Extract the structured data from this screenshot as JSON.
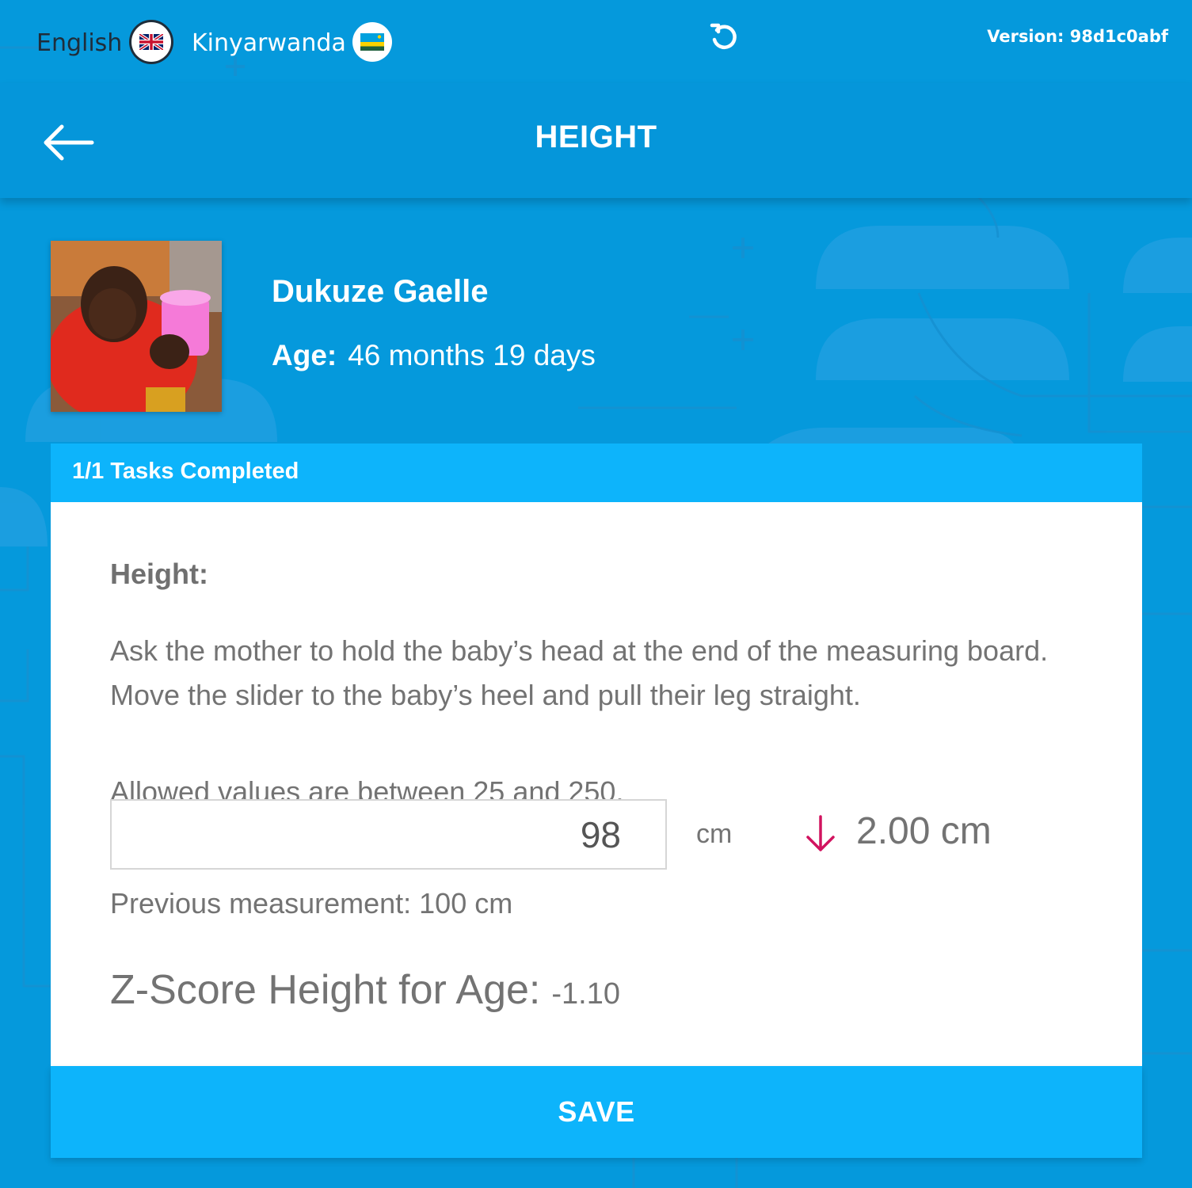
{
  "colors": {
    "background": "#0599dc",
    "header": "#0596da",
    "accent_bar": "#0db4fb",
    "card": "#ffffff",
    "text_gray": "#737373",
    "arrow_down": "#d1135f"
  },
  "language_bar": {
    "english_label": "English",
    "english_flag_icon": "uk-flag-icon",
    "kinyarwanda_label": "Kinyarwanda",
    "kinyarwanda_flag_icon": "rwanda-flag-icon",
    "refresh_icon": "refresh-icon",
    "version": "Version: 98d1c0abf"
  },
  "header": {
    "back_icon": "arrow-left-icon",
    "title": "HEIGHT"
  },
  "person": {
    "name": "Dukuze Gaelle",
    "age_label": "Age:",
    "age_value": "46 months 19 days"
  },
  "card": {
    "tasks_completed": "1/1 Tasks Completed",
    "field_title": "Height:",
    "instructions": "Ask the mother to hold the baby’s head at the end of the measuring board. Move the slider to the baby’s heel and pull their leg straight.",
    "allowed_values": "Allowed values are between 25 and 250.",
    "height_value": "98",
    "unit": "cm",
    "diff_icon": "arrow-down-icon",
    "diff_value": "2.00 cm",
    "previous_measurement": "Previous measurement: 100 cm",
    "zscore_label": "Z-Score Height for Age:",
    "zscore_value": "-1.10",
    "save_label": "SAVE"
  }
}
